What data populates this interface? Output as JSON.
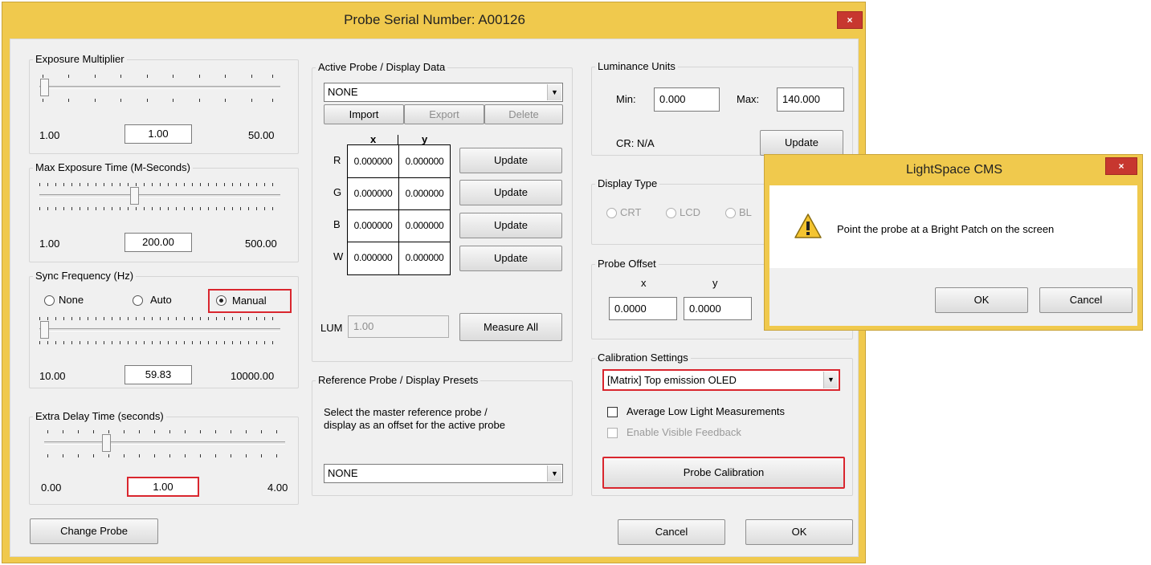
{
  "window": {
    "title": "Probe Serial Number: A00126",
    "close_glyph": "×"
  },
  "exposure_multiplier": {
    "title": "Exposure Multiplier",
    "min": "1.00",
    "value": "1.00",
    "max": "50.00"
  },
  "max_exposure": {
    "title": "Max Exposure Time (M-Seconds)",
    "min": "1.00",
    "value": "200.00",
    "max": "500.00"
  },
  "sync_frequency": {
    "title": "Sync Frequency (Hz)",
    "options": [
      "None",
      "Auto",
      "Manual"
    ],
    "selected": "Manual",
    "min": "10.00",
    "value": "59.83",
    "max": "10000.00"
  },
  "extra_delay": {
    "title": "Extra Delay Time (seconds)",
    "min": "0.00",
    "value": "1.00",
    "max": "4.00"
  },
  "change_probe_label": "Change Probe",
  "active_probe": {
    "title": "Active Probe / Display Data",
    "selected": "NONE",
    "import_label": "Import",
    "export_label": "Export",
    "delete_label": "Delete",
    "col_x": "x",
    "col_y": "y",
    "rows": [
      {
        "label": "R",
        "x": "0.000000",
        "y": "0.000000",
        "button": "Update"
      },
      {
        "label": "G",
        "x": "0.000000",
        "y": "0.000000",
        "button": "Update"
      },
      {
        "label": "B",
        "x": "0.000000",
        "y": "0.000000",
        "button": "Update"
      },
      {
        "label": "W",
        "x": "0.000000",
        "y": "0.000000",
        "button": "Update"
      }
    ],
    "lum_label": "LUM",
    "lum_value": "1.00",
    "measure_all_label": "Measure All"
  },
  "reference_probe": {
    "title": "Reference Probe / Display Presets",
    "description_line1": "Select the master reference probe /",
    "description_line2": "display as an offset for the active probe",
    "selected": "NONE"
  },
  "luminance": {
    "title": "Luminance Units",
    "min_label": "Min:",
    "min_value": "0.000",
    "max_label": "Max:",
    "max_value": "140.000",
    "cr_label": "CR: N/A",
    "update_label": "Update"
  },
  "display_type": {
    "title": "Display Type",
    "options": [
      "CRT",
      "LCD",
      "BL"
    ]
  },
  "probe_offset": {
    "title": "Probe Offset",
    "x_label": "x",
    "y_label": "y",
    "x_value": "0.0000",
    "y_value": "0.0000"
  },
  "calibration": {
    "title": "Calibration Settings",
    "selected": "[Matrix] Top emission OLED",
    "avg_low_light": "Average Low Light Measurements",
    "visible_feedback": "Enable Visible Feedback",
    "probe_calibration_label": "Probe Calibration"
  },
  "footer": {
    "cancel_label": "Cancel",
    "ok_label": "OK"
  },
  "dialog": {
    "title": "LightSpace CMS",
    "close_glyph": "×",
    "message": "Point the probe at a Bright Patch on the screen",
    "ok_label": "OK",
    "cancel_label": "Cancel",
    "icon": "warning-icon"
  },
  "colors": {
    "window_frame": "#f0c94d",
    "close_button": "#c7372f",
    "highlight_box": "#d9262e",
    "client_bg": "#f0f0f0"
  }
}
